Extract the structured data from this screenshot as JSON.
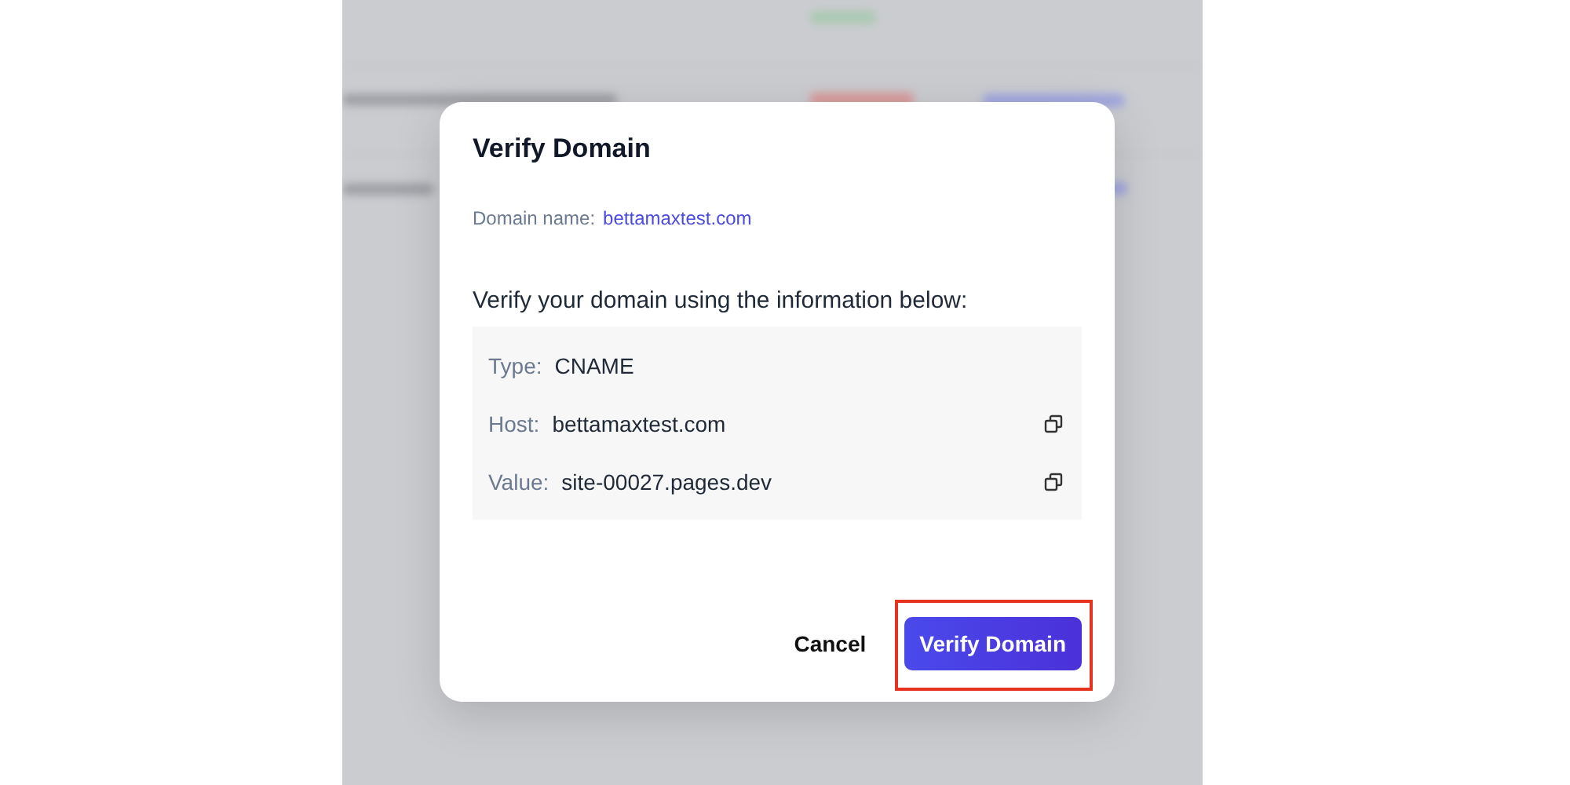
{
  "dialog": {
    "title": "Verify Domain",
    "domain_label": "Domain name:",
    "domain_value": "bettamaxtest.com",
    "instructions": "Verify your domain using the information below:",
    "records": [
      {
        "label": "Type:",
        "value": "CNAME",
        "copyable": false
      },
      {
        "label": "Host:",
        "value": "bettamaxtest.com",
        "copyable": true
      },
      {
        "label": "Value:",
        "value": "site-00027.pages.dev",
        "copyable": true
      }
    ],
    "buttons": [
      {
        "label": "Cancel",
        "kind": "secondary",
        "highlighted": false
      },
      {
        "label": "Verify Domain",
        "kind": "primary",
        "highlighted": true
      }
    ]
  }
}
